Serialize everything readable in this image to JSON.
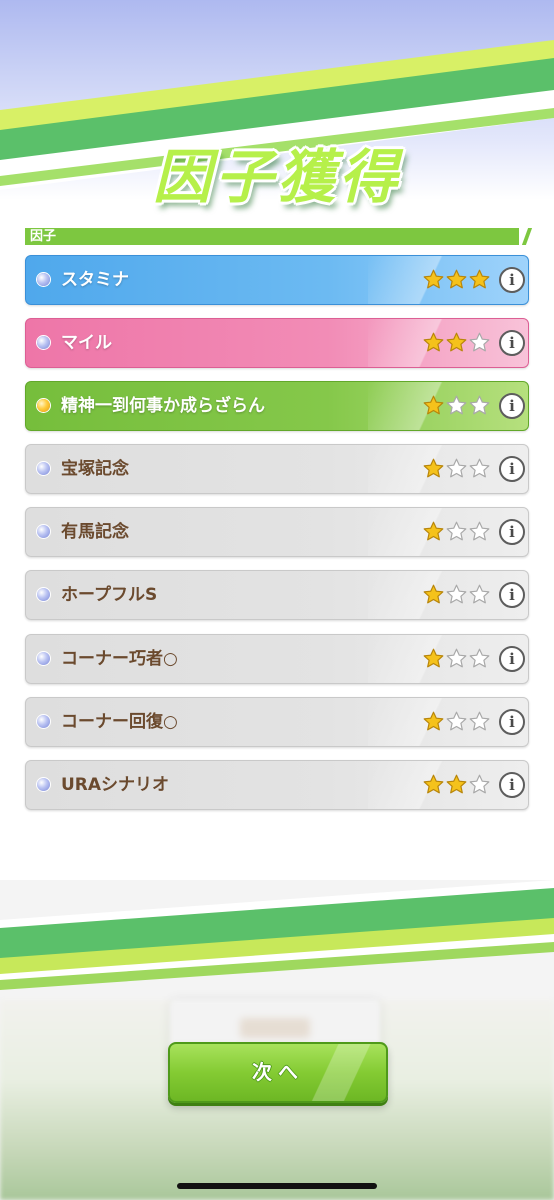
{
  "header": {
    "title": "因子獲得"
  },
  "section": {
    "label": "因子"
  },
  "factors": [
    {
      "name": "スタミナ",
      "type": "blue",
      "stars": 3
    },
    {
      "name": "マイル",
      "type": "pink",
      "stars": 2
    },
    {
      "name": "精神一到何事か成らざらん",
      "type": "green",
      "stars": 1
    },
    {
      "name": "宝塚記念",
      "type": "gray",
      "stars": 1
    },
    {
      "name": "有馬記念",
      "type": "gray",
      "stars": 1
    },
    {
      "name": "ホープフルS",
      "type": "gray",
      "stars": 1
    },
    {
      "name": "コーナー巧者○",
      "type": "gray",
      "stars": 1
    },
    {
      "name": "コーナー回復○",
      "type": "gray",
      "stars": 1
    },
    {
      "name": "URAシナリオ",
      "type": "gray",
      "stars": 2
    }
  ],
  "max_stars": 3,
  "icons": {
    "info": "i",
    "star": "star-icon",
    "dot": "factor-dot-icon"
  },
  "buttons": {
    "next_label": "次へ"
  },
  "colors": {
    "blue": "#4fa8ec",
    "pink": "#ee76a8",
    "green": "#76be3c",
    "gray": "#dedede",
    "star_filled": "#f5c21b",
    "star_empty": "#ffffff",
    "accent_green": "#7dc740"
  }
}
